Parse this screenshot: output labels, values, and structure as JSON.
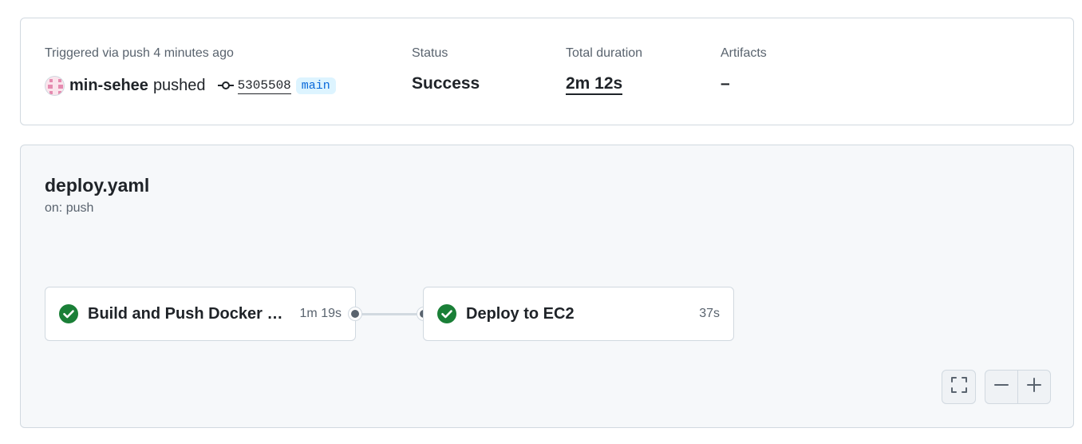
{
  "summary": {
    "trigger_text": "Triggered via push 4 minutes ago",
    "actor": "min-sehee",
    "action": "pushed",
    "commit_sha": "5305508",
    "branch": "main",
    "status_label": "Status",
    "status_value": "Success",
    "duration_label": "Total duration",
    "duration_value": "2m 12s",
    "artifacts_label": "Artifacts",
    "artifacts_value": "–"
  },
  "workflow": {
    "title": "deploy.yaml",
    "trigger": "on: push",
    "jobs": [
      {
        "name": "Build and Push Docker Image",
        "duration": "1m 19s",
        "status": "success"
      },
      {
        "name": "Deploy to EC2",
        "duration": "37s",
        "status": "success"
      }
    ]
  },
  "icons": {
    "success": "check-circle-icon",
    "commit": "git-commit-icon",
    "fullscreen": "fullscreen-icon",
    "zoom_out": "minus-icon",
    "zoom_in": "plus-icon"
  },
  "colors": {
    "success": "#1a7f37",
    "branch_text": "#0969da",
    "branch_bg": "#ddf4ff"
  }
}
